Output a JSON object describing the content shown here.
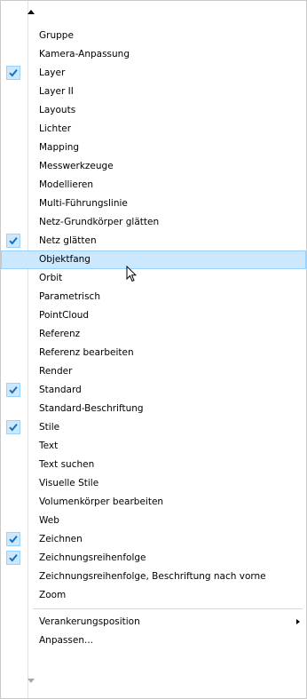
{
  "menu": {
    "scroll_up_icon": "triangle-up-icon",
    "scroll_down_icon": "triangle-down-icon",
    "items": [
      {
        "label": "Gruppe",
        "checked": false
      },
      {
        "label": "Kamera-Anpassung",
        "checked": false
      },
      {
        "label": "Layer",
        "checked": true
      },
      {
        "label": "Layer II",
        "checked": false
      },
      {
        "label": "Layouts",
        "checked": false
      },
      {
        "label": "Lichter",
        "checked": false
      },
      {
        "label": "Mapping",
        "checked": false
      },
      {
        "label": "Messwerkzeuge",
        "checked": false
      },
      {
        "label": "Modellieren",
        "checked": false
      },
      {
        "label": "Multi-Führungslinie",
        "checked": false
      },
      {
        "label": "Netz-Grundkörper glätten",
        "checked": false
      },
      {
        "label": "Netz glätten",
        "checked": true
      },
      {
        "label": "Objektfang",
        "checked": false,
        "highlighted": true
      },
      {
        "label": "Orbit",
        "checked": false
      },
      {
        "label": "Parametrisch",
        "checked": false
      },
      {
        "label": "PointCloud",
        "checked": false
      },
      {
        "label": "Referenz",
        "checked": false
      },
      {
        "label": "Referenz bearbeiten",
        "checked": false
      },
      {
        "label": "Render",
        "checked": false
      },
      {
        "label": "Standard",
        "checked": true
      },
      {
        "label": "Standard-Beschriftung",
        "checked": false
      },
      {
        "label": "Stile",
        "checked": true
      },
      {
        "label": "Text",
        "checked": false
      },
      {
        "label": "Text suchen",
        "checked": false
      },
      {
        "label": "Visuelle Stile",
        "checked": false
      },
      {
        "label": "Volumenkörper bearbeiten",
        "checked": false
      },
      {
        "label": "Web",
        "checked": false
      },
      {
        "label": "Zeichnen",
        "checked": true
      },
      {
        "label": "Zeichnungsreihenfolge",
        "checked": true
      },
      {
        "label": "Zeichnungsreihenfolge, Beschriftung nach vorne",
        "checked": false
      },
      {
        "label": "Zoom",
        "checked": false
      }
    ],
    "footer_items": [
      {
        "label": "Verankerungsposition",
        "submenu": true
      },
      {
        "label": "Anpassen...",
        "submenu": false
      }
    ]
  },
  "colors": {
    "highlight_bg": "#cce8ff",
    "highlight_border": "#99d1ff",
    "check": "#1e6fb5"
  }
}
